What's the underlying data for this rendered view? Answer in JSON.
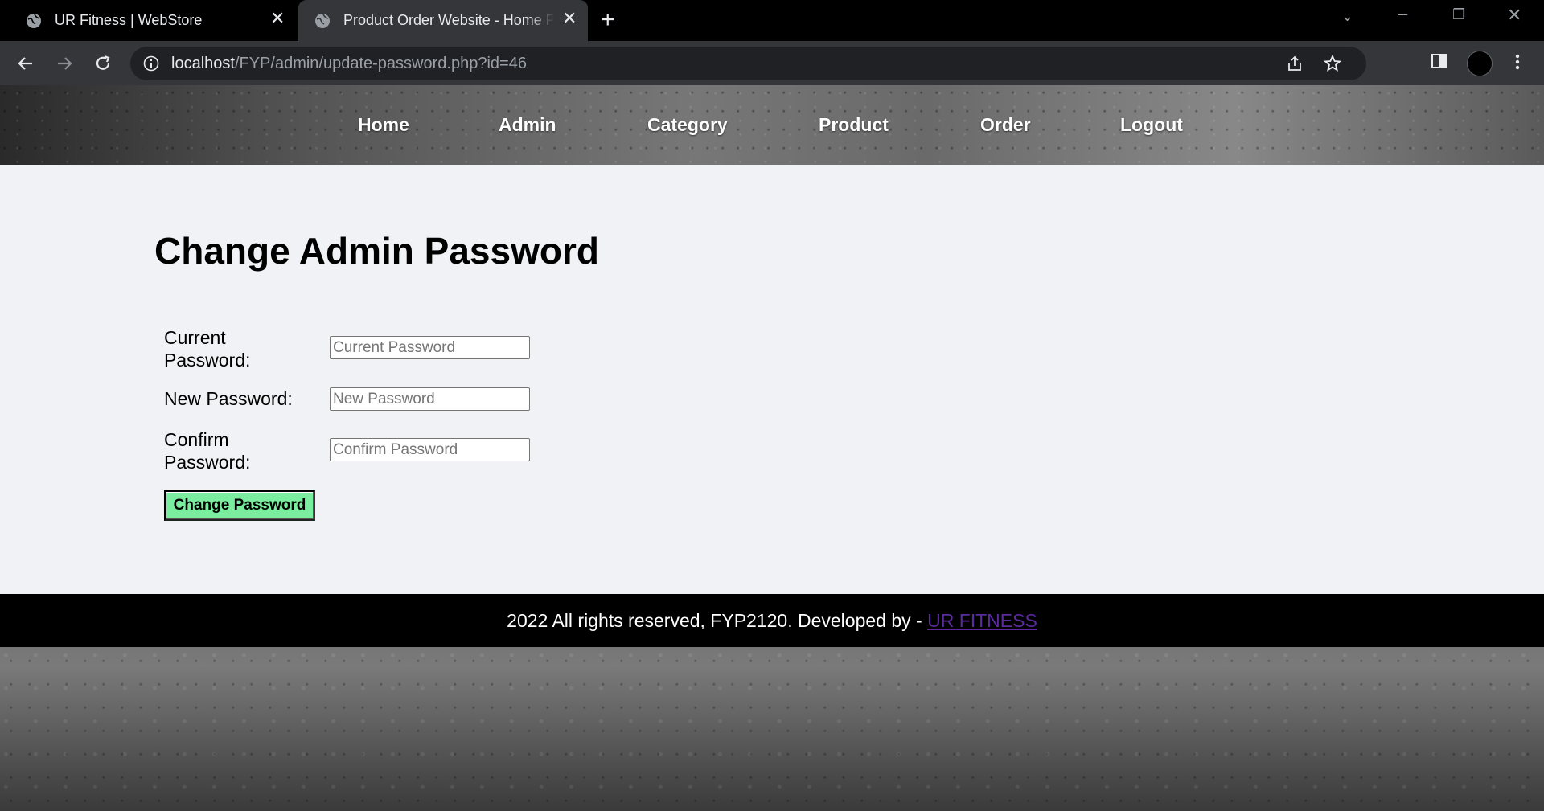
{
  "browser": {
    "tabs": [
      {
        "title": "UR Fitness | WebStore",
        "active": false
      },
      {
        "title": "Product Order Website - Home Page",
        "active": true
      }
    ],
    "url_host": "localhost",
    "url_path": "/FYP/admin/update-password.php?id=46"
  },
  "menu": {
    "items": [
      "Home",
      "Admin",
      "Category",
      "Product",
      "Order",
      "Logout"
    ]
  },
  "main": {
    "title": "Change Admin Password",
    "fields": [
      {
        "label": "Current Password:",
        "placeholder": "Current Password",
        "value": ""
      },
      {
        "label": "New Password:",
        "placeholder": "New Password",
        "value": ""
      },
      {
        "label": "Confirm Password:",
        "placeholder": "Confirm Password",
        "value": ""
      }
    ],
    "submit_label": "Change Password"
  },
  "footer": {
    "text": "2022 All rights reserved, FYP2120. Developed by - ",
    "link_text": "UR FITNESS"
  },
  "colors": {
    "button_bg": "#7bed9f",
    "content_bg": "#f1f2f6",
    "link": "#5b2a9e"
  }
}
